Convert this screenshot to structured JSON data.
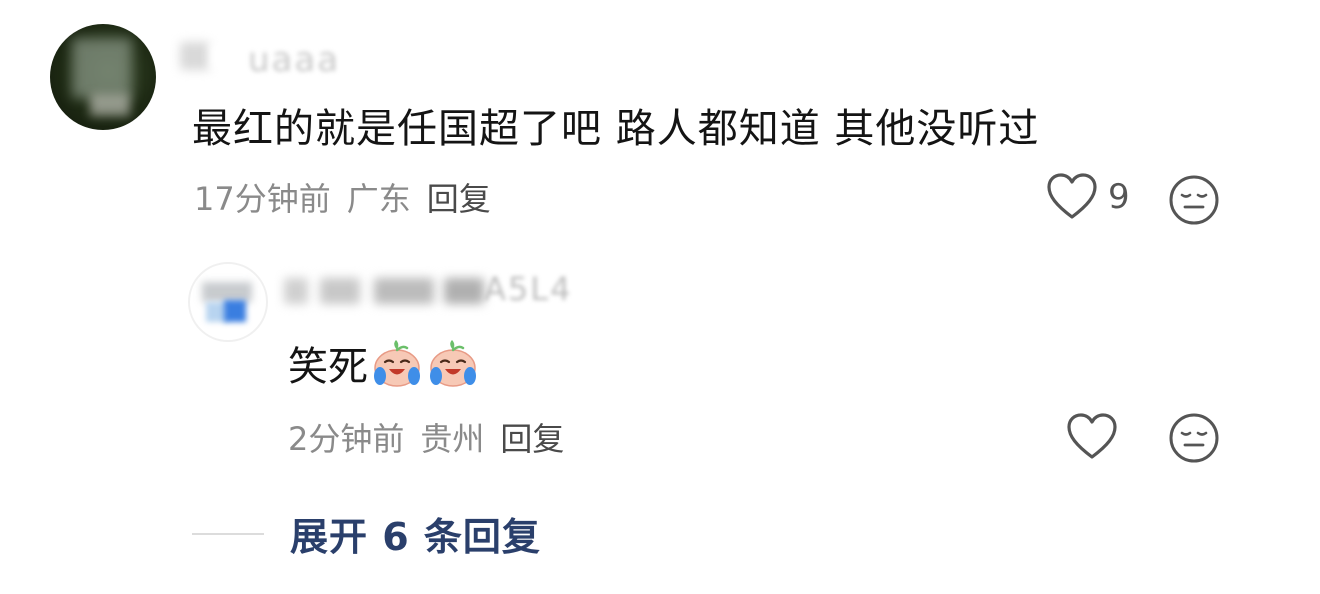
{
  "comment": {
    "username_partial": "uaaa",
    "text": "最红的就是任国超了吧 路人都知道 其他没听过",
    "time": "17分钟前",
    "location": "广东",
    "reply_label": "回复",
    "like_count": "9"
  },
  "reply": {
    "username_partial": "A5L4",
    "text": "笑死",
    "emoji": [
      "crying-laughing-peach-emoji",
      "crying-laughing-peach-emoji"
    ],
    "time": "2分钟前",
    "location": "贵州",
    "reply_label": "回复"
  },
  "expand": {
    "label": "展开 6 条回复"
  },
  "icons": {
    "like": "heart-outline-icon",
    "dislike": "neutral-face-icon"
  },
  "colors": {
    "text_primary": "#141414",
    "text_secondary": "#8a8a8a",
    "expand_link": "#2a3f6b",
    "icon": "#555555"
  }
}
